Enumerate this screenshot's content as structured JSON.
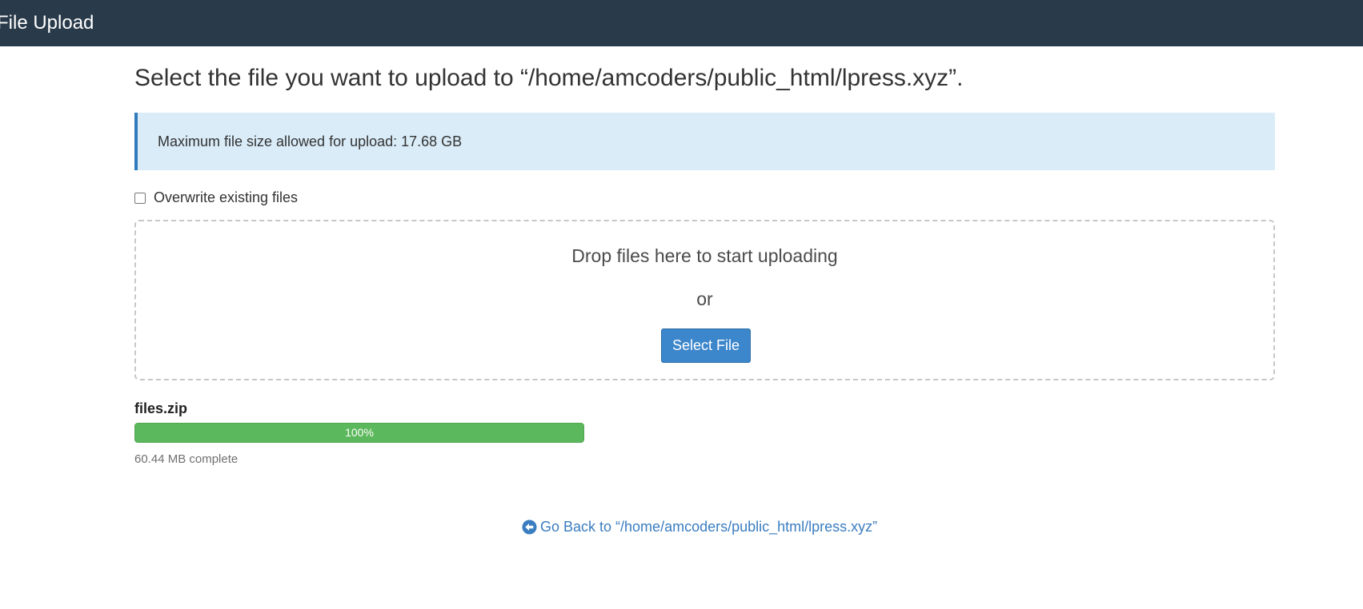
{
  "header": {
    "title": "File Upload"
  },
  "main": {
    "title": "Select the file you want to upload to “/home/amcoders/public_html/lpress.xyz”.",
    "alert": "Maximum file size allowed for upload: 17.68 GB",
    "overwrite_label": "Overwrite existing files",
    "overwrite_checked": false,
    "dropzone": {
      "drop_text": "Drop files here to start uploading",
      "or_text": "or",
      "select_button": "Select File"
    },
    "upload": {
      "file_name": "files.zip",
      "progress_label": "100%",
      "progress_fraction": 1.0,
      "status": "60.44 MB complete"
    },
    "go_back": {
      "label": "Go Back to “/home/amcoders/public_html/lpress.xyz”",
      "icon": "circle-arrow-left-icon"
    }
  },
  "colors": {
    "topbar": "#293a4a",
    "alert_bg": "#d9ecf8",
    "alert_border": "#2f7bbd",
    "primary_button": "#3c86cb",
    "progress": "#5cb85c",
    "link": "#3a7dc0"
  }
}
